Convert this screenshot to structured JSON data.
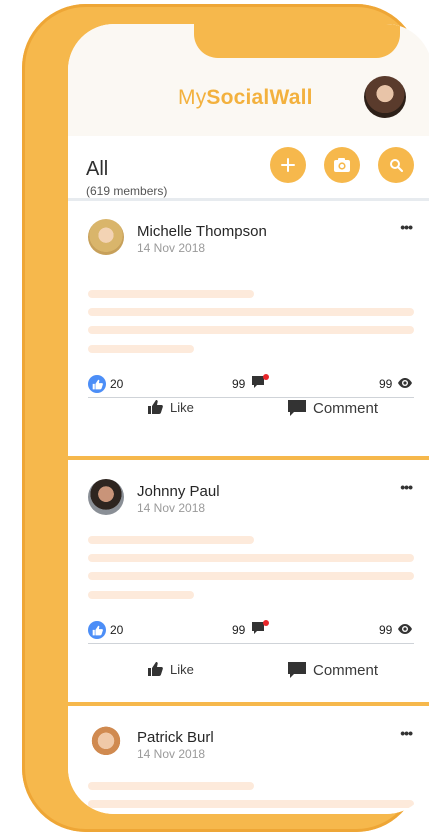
{
  "header": {
    "brand_prefix": "My",
    "brand_suffix": "SocialWall"
  },
  "filter": {
    "title": "All",
    "subtitle": "(619 members)"
  },
  "posts": [
    {
      "author": "Michelle Thompson",
      "date": "14 Nov 2018",
      "likes": "20",
      "comments": "99",
      "views": "99",
      "like_label": "Like",
      "comment_label": "Comment"
    },
    {
      "author": "Johnny Paul",
      "date": "14 Nov 2018",
      "likes": "20",
      "comments": "99",
      "views": "99",
      "like_label": "Like",
      "comment_label": "Comment"
    },
    {
      "author": "Patrick Burl",
      "date": "14 Nov 2018"
    }
  ],
  "icons": {
    "add": "plus-icon",
    "camera": "camera-icon",
    "search": "search-icon",
    "like": "thumbs-up-icon",
    "comment": "comment-icon",
    "views": "eye-icon",
    "more": "more-icon"
  },
  "colors": {
    "accent": "#f6b84c",
    "brand_text": "#f3b13e",
    "skeleton": "#fdeadb",
    "like_badge": "#4c8ef7",
    "notification_dot": "#e8262a"
  }
}
